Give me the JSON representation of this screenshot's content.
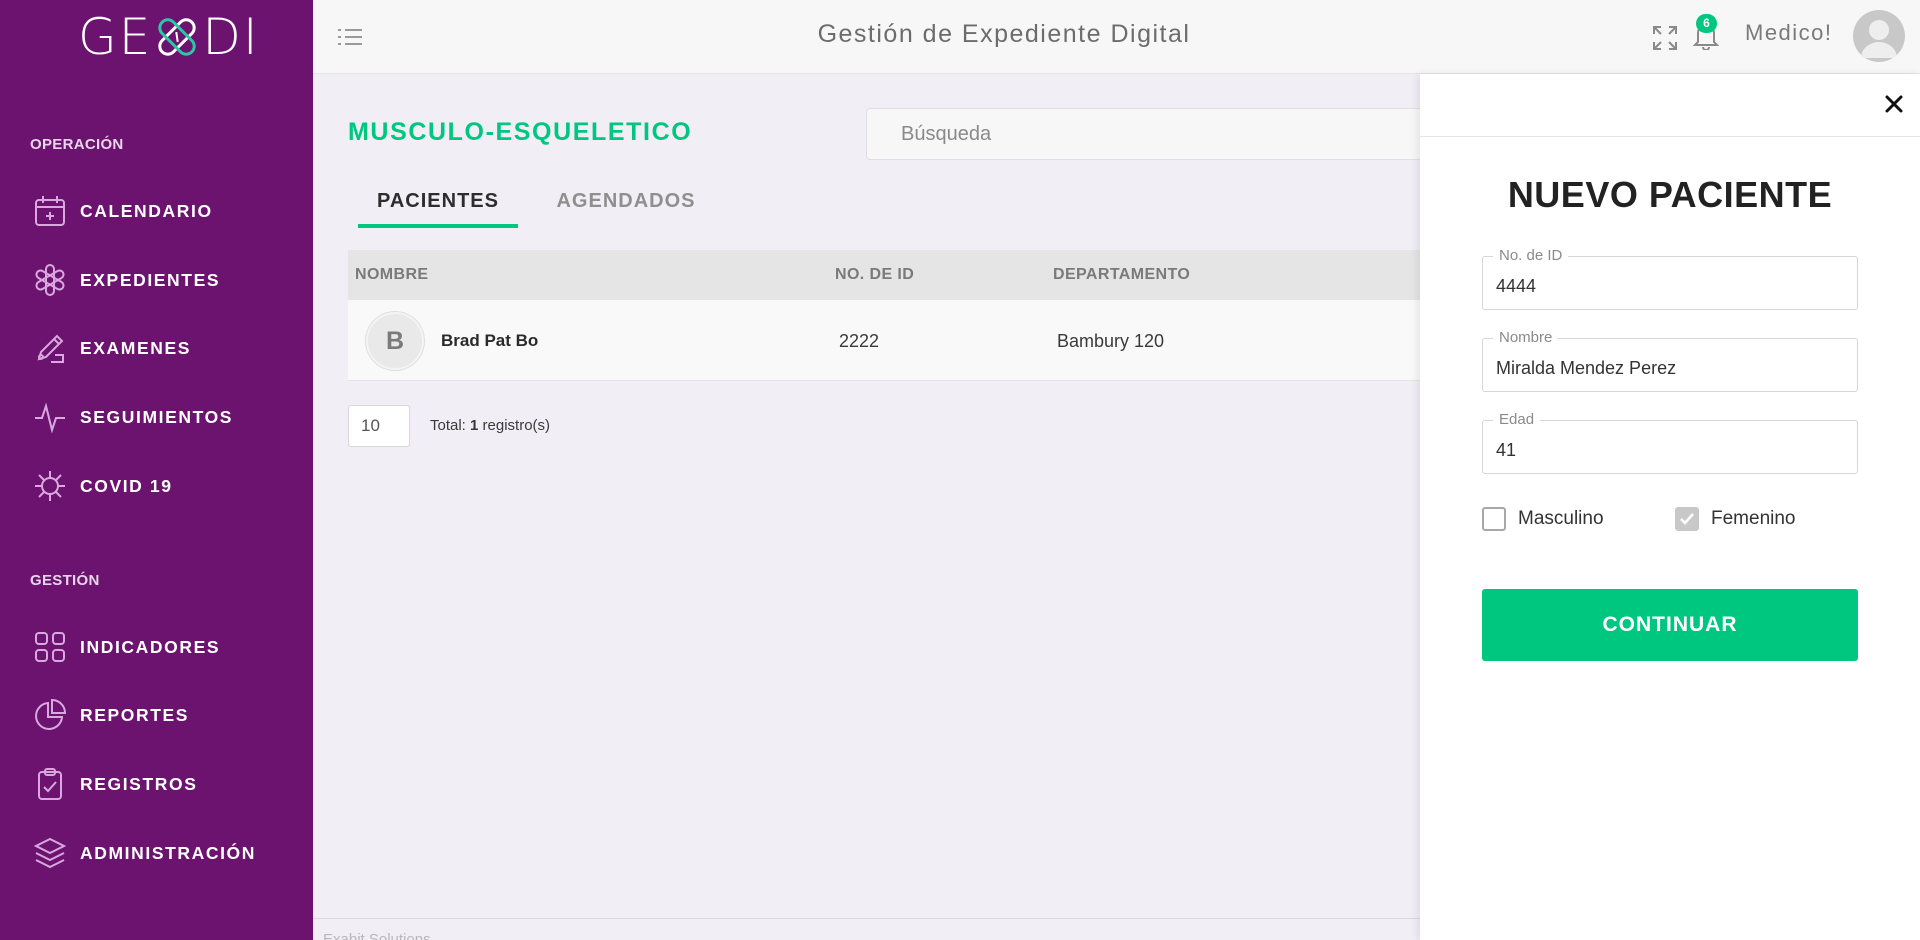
{
  "app": {
    "logo_left": "GE",
    "logo_right": "DI",
    "title": "Gestión de Expediente Digital",
    "notifications_count": "6",
    "user_name": "Medico!"
  },
  "sidebar": {
    "sections": [
      {
        "label": "OPERACIÓN",
        "items": [
          {
            "label": "CALENDARIO",
            "icon": "calendar-icon"
          },
          {
            "label": "EXPEDIENTES",
            "icon": "medical-star-icon"
          },
          {
            "label": "EXAMENES",
            "icon": "pen-icon"
          },
          {
            "label": "SEGUIMIENTOS",
            "icon": "heartbeat-icon"
          },
          {
            "label": "COVID 19",
            "icon": "virus-icon"
          }
        ]
      },
      {
        "label": "GESTIÓN",
        "items": [
          {
            "label": "INDICADORES",
            "icon": "grid-icon"
          },
          {
            "label": "REPORTES",
            "icon": "pie-chart-icon"
          },
          {
            "label": "REGISTROS",
            "icon": "clipboard-check-icon"
          },
          {
            "label": "ADMINISTRACIÓN",
            "icon": "layers-icon"
          }
        ]
      }
    ]
  },
  "main": {
    "page_title": "MUSCULO-ESQUELETICO",
    "search_placeholder": "Búsqueda",
    "tabs": [
      {
        "label": "PACIENTES",
        "active": true
      },
      {
        "label": "AGENDADOS",
        "active": false
      }
    ],
    "table": {
      "columns": [
        "NOMBRE",
        "NO. DE ID",
        "DEPARTAMENTO"
      ],
      "rows": [
        {
          "initial": "B",
          "name": "Brad Pat Bo",
          "id": "2222",
          "department": "Bambury 120"
        }
      ]
    },
    "pager": {
      "page_size": "10",
      "total_prefix": "Total: ",
      "total_count": "1",
      "total_suffix": " registro(s)"
    },
    "footer": "Exabit Solutions"
  },
  "panel": {
    "title": "NUEVO PACIENTE",
    "fields": [
      {
        "label": "No. de ID",
        "value": "4444"
      },
      {
        "label": "Nombre",
        "value": "Miralda Mendez Perez"
      },
      {
        "label": "Edad",
        "value": "41"
      }
    ],
    "gender": [
      {
        "label": "Masculino",
        "checked": false
      },
      {
        "label": "Femenino",
        "checked": true
      }
    ],
    "submit_label": "CONTINUAR"
  },
  "colors": {
    "sidebar": "#6b136e",
    "accent": "#00c780",
    "background": "#f1eef5"
  }
}
